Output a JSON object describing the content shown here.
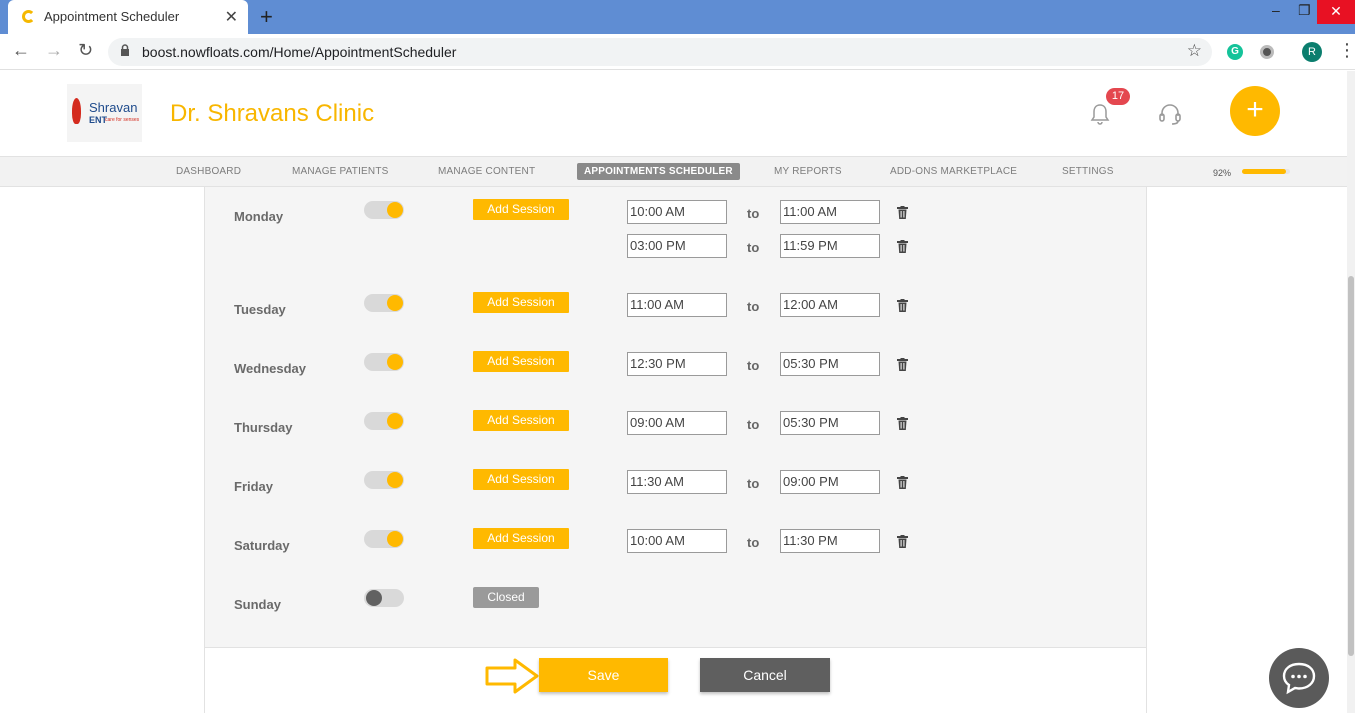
{
  "browser": {
    "tab_title": "Appointment Scheduler",
    "tab_close": "✕",
    "new_tab": "+",
    "url": "boost.nowfloats.com/Home/AppointmentScheduler",
    "profile_initial": "R",
    "extension_g": "G",
    "win_minimize": "–",
    "win_restore": "❐",
    "win_close": "✕",
    "back": "←",
    "forward": "→",
    "reload": "↻",
    "star": "☆",
    "menu": "⋮"
  },
  "header": {
    "logo_name": "Shravan",
    "logo_sub": "ENT",
    "logo_tag": "care for senses",
    "clinic_name": "Dr. Shravans Clinic",
    "notification_count": "17",
    "fab_label": "+"
  },
  "nav": {
    "items": [
      {
        "label": "DASHBOARD"
      },
      {
        "label": "MANAGE PATIENTS"
      },
      {
        "label": "MANAGE CONTENT"
      },
      {
        "label": "APPOINTMENTS SCHEDULER"
      },
      {
        "label": "MY REPORTS"
      },
      {
        "label": "ADD-ONS MARKETPLACE"
      },
      {
        "label": "SETTINGS"
      }
    ],
    "active": "APPOINTMENTS SCHEDULER",
    "progress_label": "92%",
    "progress_value": 0.92
  },
  "schedule": {
    "add_session_label": "Add Session",
    "closed_label": "Closed",
    "to_label": "to",
    "days": [
      {
        "name": "Monday",
        "enabled": true,
        "sessions": [
          {
            "from": "10:00 AM",
            "to": "11:00 AM"
          },
          {
            "from": "03:00 PM",
            "to": "11:59 PM"
          }
        ]
      },
      {
        "name": "Tuesday",
        "enabled": true,
        "sessions": [
          {
            "from": "11:00 AM",
            "to": "12:00 AM"
          }
        ]
      },
      {
        "name": "Wednesday",
        "enabled": true,
        "sessions": [
          {
            "from": "12:30 PM",
            "to": "05:30 PM"
          }
        ]
      },
      {
        "name": "Thursday",
        "enabled": true,
        "sessions": [
          {
            "from": "09:00 AM",
            "to": "05:30 PM"
          }
        ]
      },
      {
        "name": "Friday",
        "enabled": true,
        "sessions": [
          {
            "from": "11:30 AM",
            "to": "09:00 PM"
          }
        ]
      },
      {
        "name": "Saturday",
        "enabled": true,
        "sessions": [
          {
            "from": "10:00 AM",
            "to": "11:30 PM"
          }
        ]
      },
      {
        "name": "Sunday",
        "enabled": false,
        "sessions": []
      }
    ]
  },
  "actions": {
    "save_label": "Save",
    "cancel_label": "Cancel"
  },
  "colors": {
    "accent": "#ffb900",
    "clinic_title": "#f8b600",
    "badge": "#e4474f",
    "cancel": "#5f5f5f",
    "tab_strip": "#5f8dd3"
  }
}
